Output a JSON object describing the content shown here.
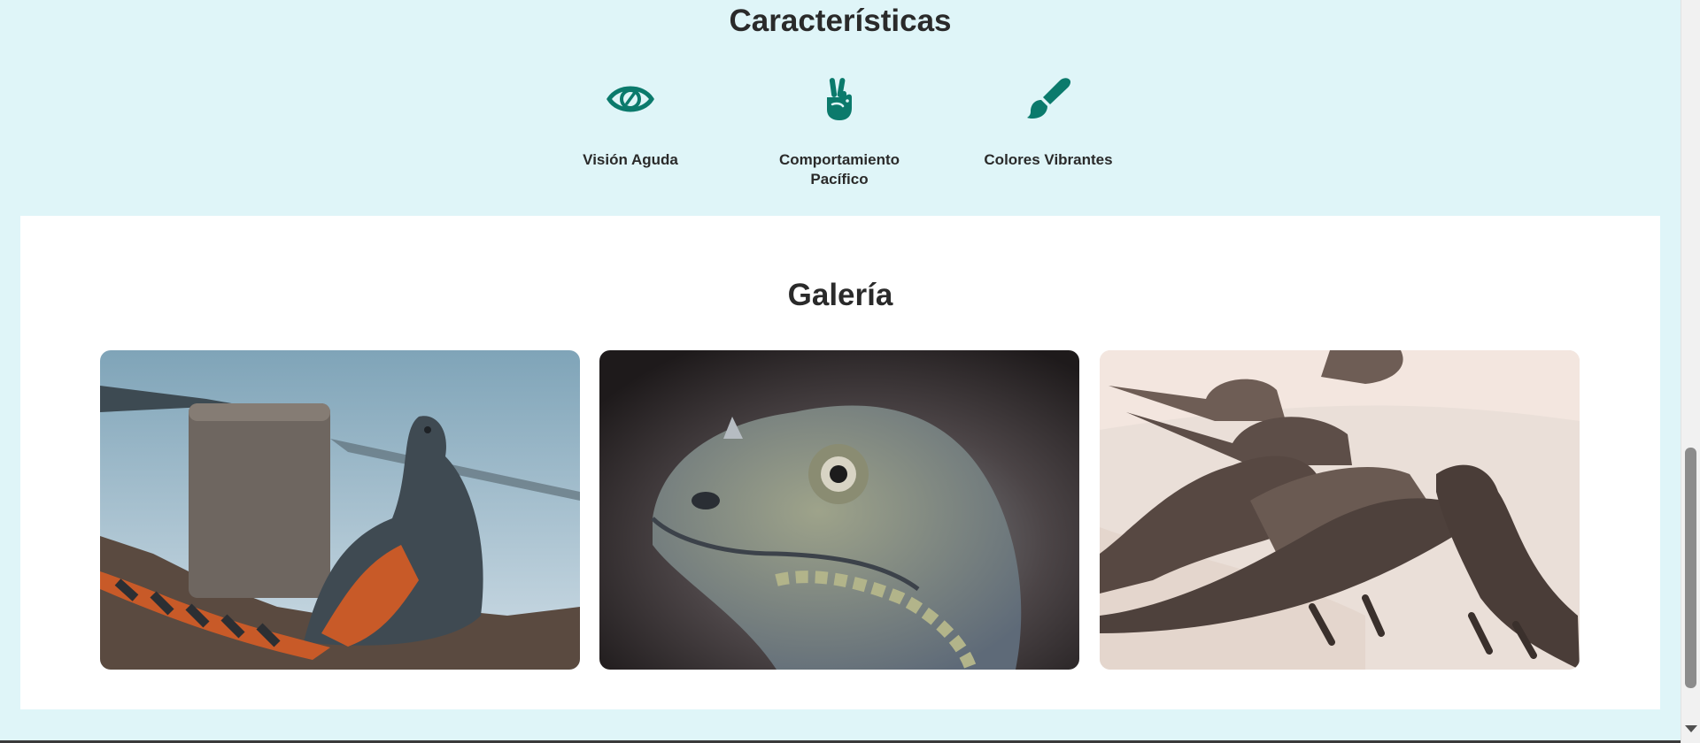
{
  "features": {
    "title": "Características",
    "items": [
      {
        "label": "Visión Aguda",
        "icon": "eye-icon"
      },
      {
        "label": "Comportamiento Pacífico",
        "icon": "peace-hand-icon"
      },
      {
        "label": "Colores Vibrantes",
        "icon": "paintbrush-icon"
      }
    ],
    "icon_color": "#0b7a6c"
  },
  "gallery": {
    "title": "Galería",
    "photos": [
      {
        "name": "iguana-by-water-photo"
      },
      {
        "name": "iguana-head-closeup-photo"
      },
      {
        "name": "iguanas-on-sand-photo"
      }
    ]
  },
  "colors": {
    "page_background": "#dff5f8",
    "card_background": "#ffffff",
    "heading_text": "#2a2a2a"
  }
}
